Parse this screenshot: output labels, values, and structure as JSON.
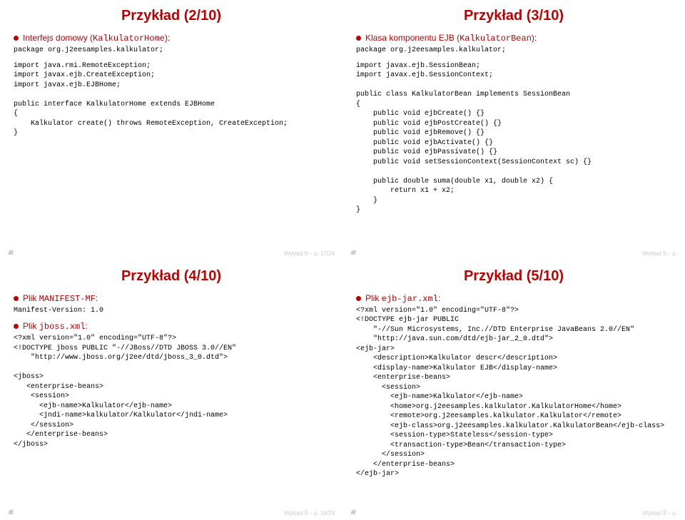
{
  "slides": [
    {
      "title": "Przykład (2/10)",
      "bullet": "Interfejs domowy (",
      "bullet_mono": "KalkulatorHome",
      "bullet_tail": "):",
      "code1": "package org.j2eesamples.kalkulator;",
      "code2": "import java.rmi.RemoteException;\nimport javax.ejb.CreateException;\nimport javax.ejb.EJBHome;\n\npublic interface KalkulatorHome extends EJBHome\n{\n    Kalkulator create() throws RemoteException, CreateException;\n}",
      "footer": "Wykład 9 – p. 17/24"
    },
    {
      "title": "Przykład (3/10)",
      "bullet": "Klasa komponentu EJB (",
      "bullet_mono": "KalkulatorBean",
      "bullet_tail": "):",
      "code1": "package org.j2eesamples.kalkulator;",
      "code2": "import javax.ejb.SessionBean;\nimport javax.ejb.SessionContext;\n\npublic class KalkulatorBean implements SessionBean\n{\n    public void ejbCreate() {}\n    public void ejbPostCreate() {}\n    public void ejbRemove() {}\n    public void ejbActivate() {}\n    public void ejbPassivate() {}\n    public void setSessionContext(SessionContext sc) {}\n\n    public double suma(double x1, double x2) {\n        return x1 + x2;\n    }\n}",
      "footer": "Wykład 9 – p."
    },
    {
      "title": "Przykład (4/10)",
      "bullet1": "Plik ",
      "bullet1_mono": "MANIFEST-MF",
      "bullet1_tail": ":",
      "code1": "Manifest-Version: 1.0",
      "bullet2": "Plik ",
      "bullet2_mono": "jboss.xml",
      "bullet2_tail": ":",
      "code2": "<?xml version=\"1.0\" encoding=\"UTF-8\"?>\n<!DOCTYPE jboss PUBLIC \"-//JBoss//DTD JBOSS 3.0//EN\"\n    \"http://www.jboss.org/j2ee/dtd/jboss_3_0.dtd\">\n\n<jboss>\n   <enterprise-beans>\n    <session>\n      <ejb-name>Kalkulator</ejb-name>\n      <jndi-name>kalkulator/Kalkulator</jndi-name>\n    </session>\n   </enterprise-beans>\n</jboss>",
      "footer": "Wykład 9 – p. 19/24"
    },
    {
      "title": "Przykład (5/10)",
      "bullet1": "Plik ",
      "bullet1_mono": "ejb-jar.xml",
      "bullet1_tail": ":",
      "code1": "<?xml version=\"1.0\" encoding=\"UTF-8\"?>\n<!DOCTYPE ejb-jar PUBLIC\n    \"-//Sun Microsystems, Inc.//DTD Enterprise JavaBeans 2.0//EN\"\n    \"http://java.sun.com/dtd/ejb-jar_2_0.dtd\">\n<ejb-jar>\n    <description>Kalkulator descr</description>\n    <display-name>Kalkulator EJB</display-name>\n    <enterprise-beans>\n      <session>\n        <ejb-name>Kalkulator</ejb-name>\n        <home>org.j2eesamples.kalkulator.KalkulatorHome</home>\n        <remote>org.j2eesamples.kalkulator.Kalkulator</remote>\n        <ejb-class>org.j2eesamples.kalkulator.KalkulatorBean</ejb-class>\n        <session-type>Stateless</session-type>\n        <transaction-type>Bean</transaction-type>\n      </session>\n    </enterprise-beans>\n</ejb-jar>",
      "footer": "Wykład 9 – p."
    }
  ]
}
